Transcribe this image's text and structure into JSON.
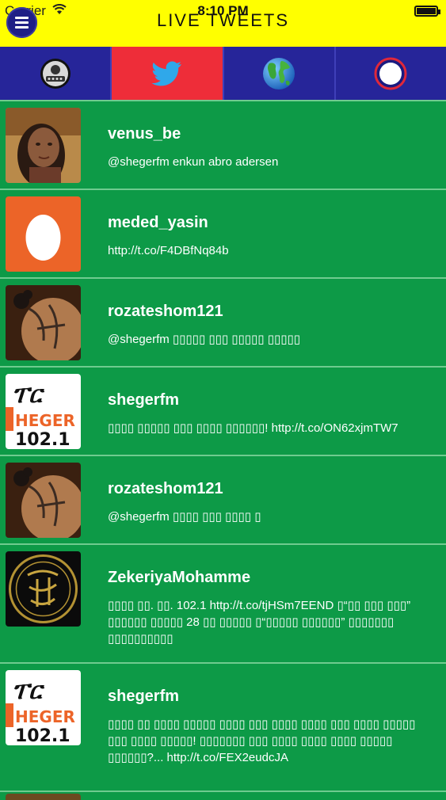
{
  "status_bar": {
    "carrier": "Carrier",
    "time": "8:10 PM"
  },
  "header": {
    "title": "LIVE TWEETS"
  },
  "tabs": [
    {
      "name": "radio",
      "icon": "radio-logo-icon",
      "active": false
    },
    {
      "name": "twitter",
      "icon": "twitter-bird-icon",
      "active": true
    },
    {
      "name": "web",
      "icon": "globe-icon",
      "active": false
    },
    {
      "name": "record",
      "icon": "record-circle-icon",
      "active": false
    }
  ],
  "tweets": [
    {
      "user": "venus_be",
      "text": "@shegerfm enkun abro adersen",
      "avatar": "portrait-avatar"
    },
    {
      "user": "meded_yasin",
      "text": "http://t.co/F4DBfNq84b",
      "avatar": "default-egg-avatar"
    },
    {
      "user": "rozateshom121",
      "text": "@shegerfm ▯▯▯▯▯ ▯▯▯ ▯▯▯▯▯ ▯▯▯▯▯",
      "avatar": "tattoo-avatar"
    },
    {
      "user": "shegerfm",
      "text": "▯▯▯▯ ▯▯▯▯▯ ▯▯▯ ▯▯▯▯ ▯▯▯▯▯▯! http://t.co/ON62xjmTW7",
      "avatar": "sheger-logo-avatar"
    },
    {
      "user": "rozateshom121",
      "text": "@shegerfm ▯▯▯▯ ▯▯▯ ▯▯▯▯ ▯",
      "avatar": "tattoo-avatar"
    },
    {
      "user": "ZekeriyaMohamme",
      "text": "▯▯▯▯ ▯▯. ▯▯. 102.1 http://t.co/tjHSm7EEND ▯“▯▯ ▯▯▯ ▯▯▯” ▯▯▯▯▯▯ ▯▯▯▯▯ 28 ▯▯ ▯▯▯▯▯ ▯“▯▯▯▯▯ ▯▯▯▯▯▯” ▯▯▯▯▯▯▯ ▯▯▯▯▯▯▯▯▯▯",
      "avatar": "calligraphy-avatar"
    },
    {
      "user": "shegerfm",
      "text": "▯▯▯▯ ▯▯ ▯▯▯▯ ▯▯▯▯▯ ▯▯▯▯ ▯▯▯ ▯▯▯▯ ▯▯▯▯ ▯▯▯ ▯▯▯▯ ▯▯▯▯▯ ▯▯▯ ▯▯▯▯ ▯▯▯▯▯! ▯▯▯▯▯▯▯ ▯▯▯ ▯▯▯▯ ▯▯▯▯ ▯▯▯▯ ▯▯▯▯▯ ▯▯▯▯▯▯?... http://t.co/FEX2eudcJA",
      "avatar": "sheger-logo-avatar"
    }
  ],
  "colors": {
    "header_bg": "#ffff00",
    "tab_bg": "#24239a",
    "tab_active_bg": "#ee2d39",
    "feed_bg": "#0d9a47",
    "separator": "#6fcb8f"
  }
}
